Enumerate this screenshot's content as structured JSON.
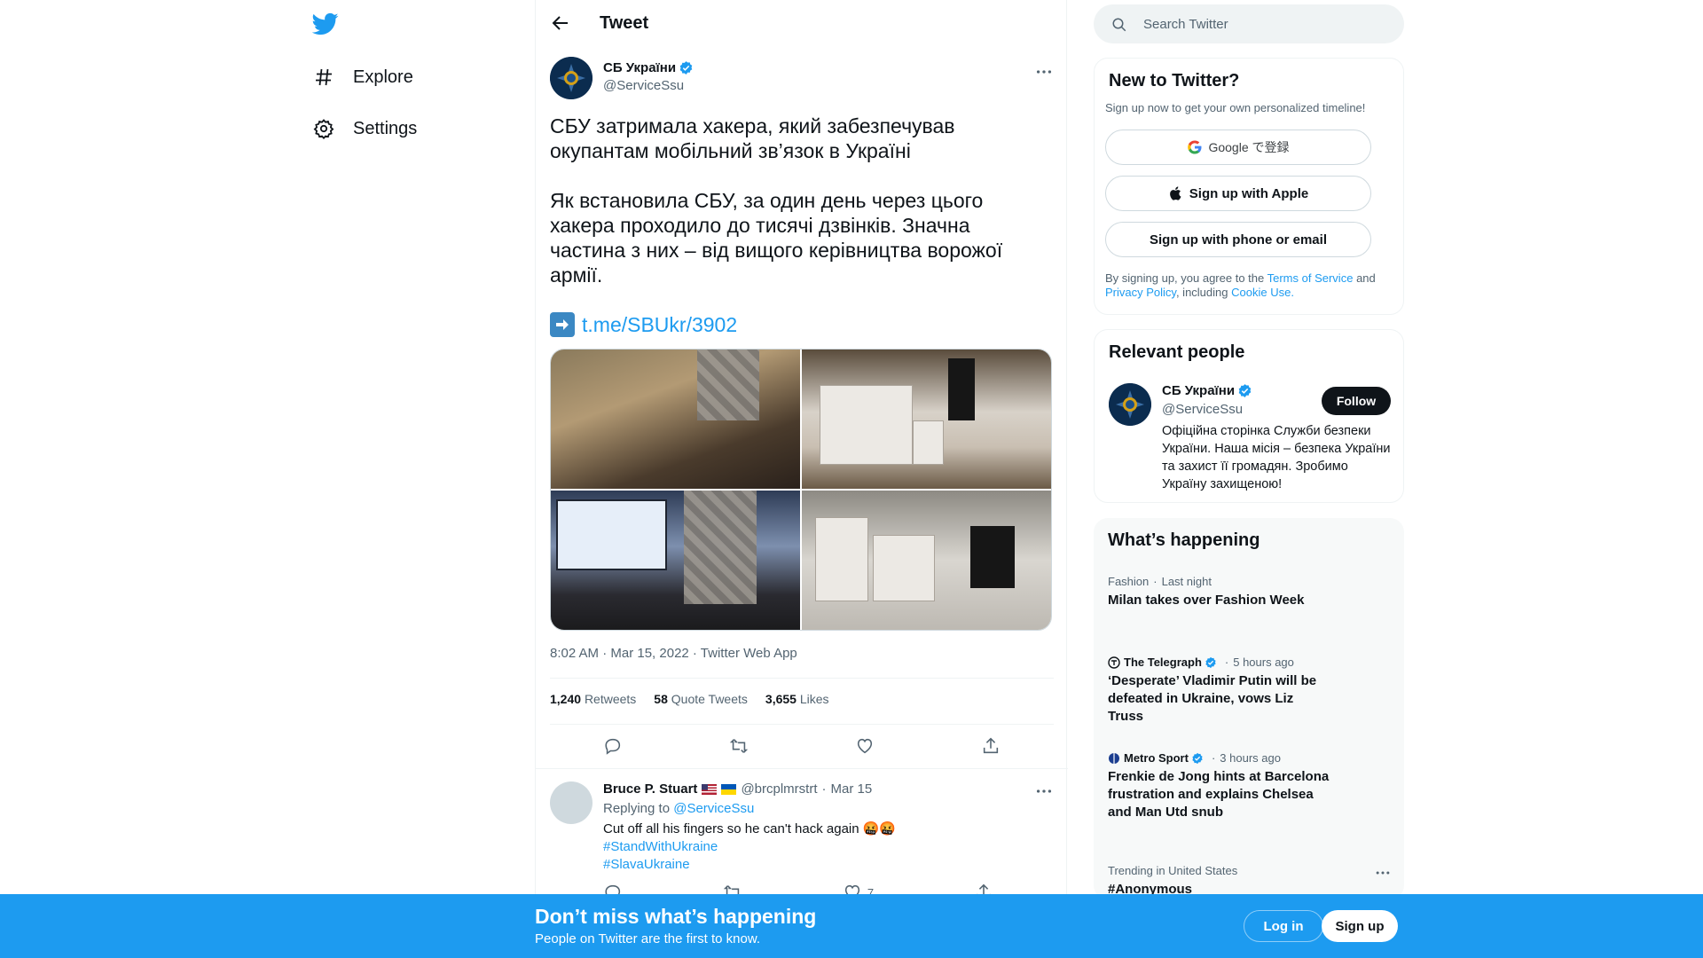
{
  "nav": {
    "items": [
      {
        "label": "Explore",
        "icon": "hashtag-icon"
      },
      {
        "label": "Settings",
        "icon": "gear-icon"
      }
    ]
  },
  "header": {
    "title": "Tweet"
  },
  "tweet": {
    "author_name": "СБ України",
    "author_handle": "@ServiceSsu",
    "text": "СБУ затримала хакера, який забезпечував окупантам мобільний зв’язок в Україні\n\nЯк встановила СБУ, за один день через цього хакера проходило до тисячі дзвінків. Значна частина з них – від вищого керівництва ворожої армії.",
    "link": "t.me/SBUkr/3902",
    "timestamp": "8:02 AM · Mar 15, 2022 · Twitter Web App",
    "stats": {
      "retweets_count": "1,240",
      "retweets_label": "Retweets",
      "quotes_count": "58",
      "quotes_label": "Quote Tweets",
      "likes_count": "3,655",
      "likes_label": "Likes"
    }
  },
  "reply": {
    "name": "Bruce P. Stuart",
    "handle": "@brcplmrstrt",
    "date": "Mar 15",
    "replying_prefix": "Replying to",
    "replying_to": "@ServiceSsu",
    "text": "Cut off all his fingers so he can't hack again 🤬🤬",
    "hashtags": [
      "#StandWithUkraine",
      "#SlavaUkraine"
    ],
    "like_count": "7"
  },
  "search": {
    "placeholder": "Search Twitter"
  },
  "signup": {
    "title": "New to Twitter?",
    "subtitle": "Sign up now to get your own personalized timeline!",
    "google_label": "Google で登録",
    "apple_label": "Sign up with Apple",
    "phone_label": "Sign up with phone or email",
    "terms_prefix": "By signing up, you agree to the",
    "terms_link": "Terms of Service",
    "terms_and": "and",
    "privacy_link": "Privacy Policy",
    "including": ", including",
    "cookie_link": "Cookie Use."
  },
  "people": {
    "title": "Relevant people",
    "name": "СБ України",
    "handle": "@ServiceSsu",
    "follow_label": "Follow",
    "bio": "Офіційна сторінка Служби безпеки України. Наша місія – безпека України та захист її громадян. Зробимо Україну захищеною!"
  },
  "trends": {
    "title": "What’s happening",
    "items": [
      {
        "category": "Fashion",
        "time": "Last night",
        "title": "Milan takes over Fashion Week"
      },
      {
        "source": "The Telegraph",
        "time": "5 hours ago",
        "title": "‘Desperate’ Vladimir Putin will be defeated in Ukraine, vows Liz Truss"
      },
      {
        "source": "Metro Sport",
        "time": "3 hours ago",
        "title": "Frenkie de Jong hints at Barcelona frustration and explains Chelsea and Man Utd snub"
      },
      {
        "category": "Trending in United States",
        "title": "#Anonymous"
      }
    ]
  },
  "bottom_bar": {
    "title": "Don’t miss what’s happening",
    "subtitle": "People on Twitter are the first to know.",
    "login_label": "Log in",
    "signup_label": "Sign up"
  },
  "colors": {
    "accent": "#1d9bf0",
    "text": "#0f1419",
    "secondary": "#536471"
  }
}
